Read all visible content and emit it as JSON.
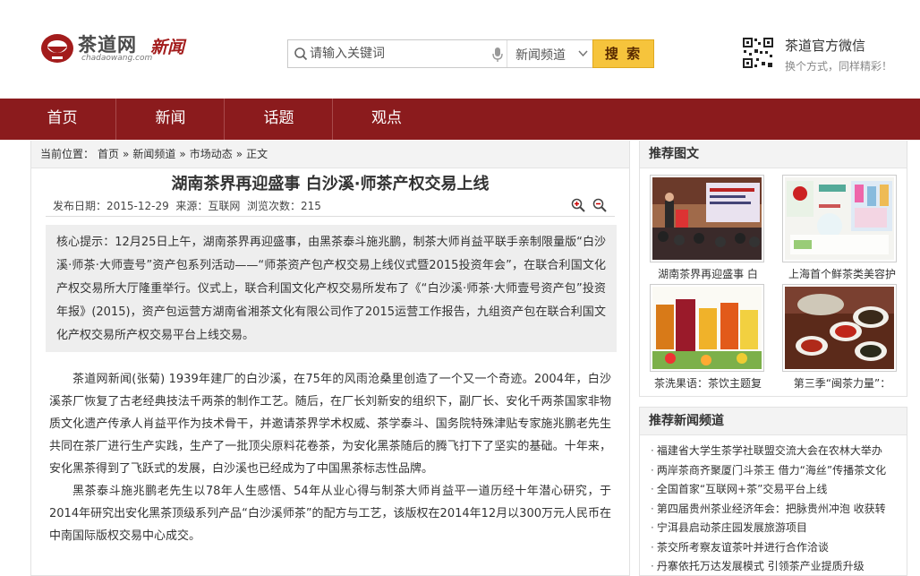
{
  "header": {
    "logo_text": "茶道网",
    "logo_domain": "chadaowang.com",
    "logo_news": "新闻",
    "search_placeholder": "请输入关键词",
    "channel": "新闻频道",
    "search_button": "搜 索",
    "wechat_title": "茶道官方微信",
    "wechat_sub": "换个方式，同样精彩！"
  },
  "nav": {
    "items": [
      {
        "label": "首页"
      },
      {
        "label": "新闻"
      },
      {
        "label": "话题"
      },
      {
        "label": "观点"
      }
    ]
  },
  "breadcrumb": {
    "prefix": "当前位置：",
    "items": [
      "首页",
      "新闻频道",
      "市场动态",
      "正文"
    ],
    "separator": "»"
  },
  "article": {
    "title": "湖南茶界再迎盛事 白沙溪·师茶产权交易上线",
    "meta": "发布日期：2015-12-29  来源：互联网  浏览次数：215",
    "summary": "核心提示：12月25日上午，湖南茶界再迎盛事，由黑茶泰斗施兆鹏，制茶大师肖益平联手亲制限量版“白沙溪·师茶·大师壹号”资产包系列活动——“师茶资产包产权交易上线仪式暨2015投资年会”，在联合利国文化产权交易所大厅隆重举行。仪式上，联合利国文化产权交易所发布了《“白沙溪·师茶·大师壹号资产包”投资年报》(2015)，资产包运营方湖南省湘茶文化有限公司作了2015运营工作报告，九组资产包在联合利国文化产权交易所产权交易平台上线交易。",
    "paragraphs": [
      "茶道网新闻(张菊) 1939年建厂的白沙溪，在75年的风雨沧桑里创造了一个又一个奇迹。2004年，白沙溪茶厂恢复了古老经典技法千两茶的制作工艺。随后，在厂长刘新安的组织下，副厂长、安化千两茶国家非物质文化遗产传承人肖益平作为技术骨干，并邀请茶界学术权威、茶学泰斗、国务院特殊津贴专家施兆鹏老先生共同在茶厂进行生产实践，生产了一批顶尖原料花卷茶，为安化黑茶随后的腾飞打下了坚实的基础。十年来，安化黑茶得到了飞跃式的发展，白沙溪也已经成为了中国黑茶标志性品牌。",
      "黑茶泰斗施兆鹏老先生以78年人生感悟、54年从业心得与制茶大师肖益平一道历经十年潜心研究，于2014年研究出安化黑茶顶级系列产品“白沙溪师茶”的配方与工艺，该版权在2014年12月以300万元人民币在中南国际版权交易中心成交。"
    ]
  },
  "sidebar": {
    "pics_title": "推荐图文",
    "pics": [
      {
        "caption": "湖南茶界再迎盛事 白"
      },
      {
        "caption": "上海首个鲜茶类美容护"
      },
      {
        "caption": "茶洗果语：茶饮主题复"
      },
      {
        "caption": "第三季“闽茶力量”："
      }
    ],
    "news_title": "推荐新闻频道",
    "news": [
      "福建省大学生茶学社联盟交流大会在农林大举办",
      "两岸茶商齐聚厦门斗茶王 借力“海丝”传播茶文化",
      "全国首家“互联网+茶”交易平台上线",
      "第四届贵州茶业经济年会：把脉贵州冲泡 收获转",
      "宁洱县启动茶庄园发展旅游项目",
      "茶交所考察友谊茶叶并进行合作洽谈",
      "丹寨依托万达发展模式 引领茶产业提质升级"
    ]
  },
  "colors": {
    "nav_bg": "#8b1b1d",
    "search_button": "#f6c43c",
    "brand_red": "#a31c1c"
  }
}
